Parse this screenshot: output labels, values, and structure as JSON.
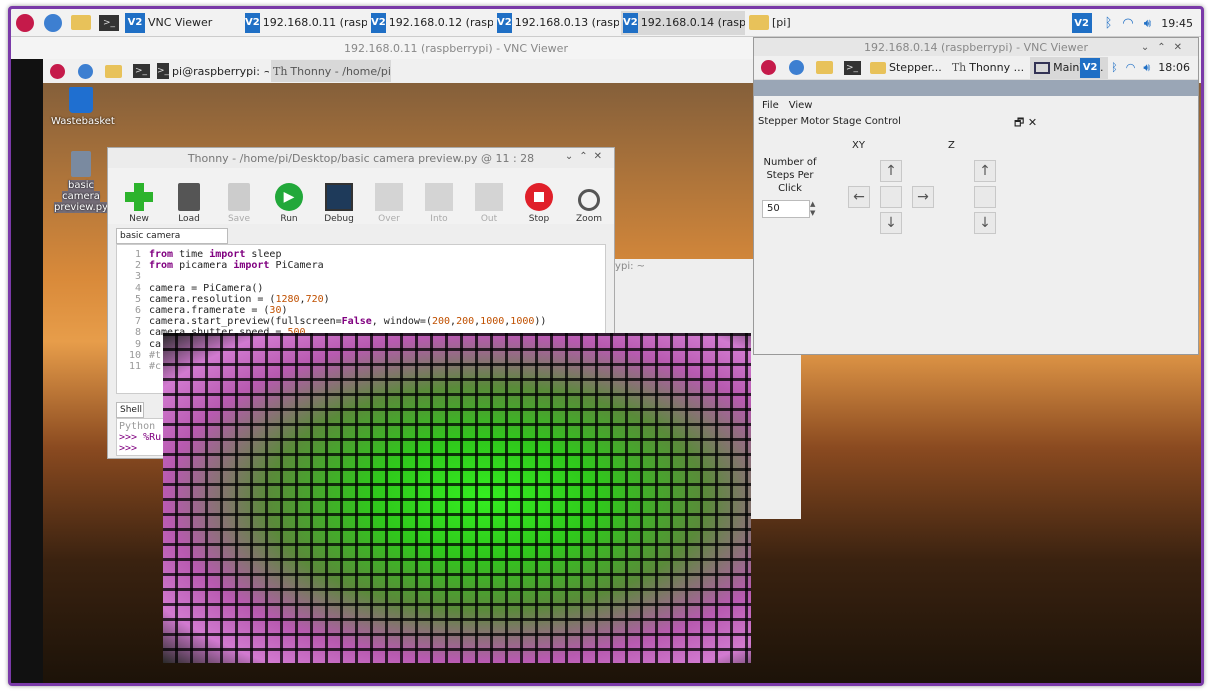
{
  "host_taskbar": {
    "tasks": [
      {
        "label": "VNC Viewer"
      },
      {
        "label": "192.168.0.11 (raspbe..."
      },
      {
        "label": "192.168.0.12 (raspbe..."
      },
      {
        "label": "192.168.0.13 (raspbe..."
      },
      {
        "label": "192.168.0.14 (raspbe..."
      },
      {
        "label": "[pi]"
      }
    ],
    "clock": "19:45"
  },
  "vnc1": {
    "title": "192.168.0.11 (raspberrypi) - VNC Viewer",
    "pi_taskbar": {
      "tasks": [
        {
          "label": "pi@raspberrypi: ~"
        },
        {
          "label": "Thonny  -  /home/pi/..."
        }
      ]
    },
    "desktop": {
      "wastebasket_label": "Wastebasket",
      "file_label": "basic camera preview.py",
      "hidden_terminal_text": "rrypi: ~"
    },
    "thonny": {
      "title": "Thonny  -  /home/pi/Desktop/basic camera preview.py  @  11 : 28",
      "toolbar": [
        {
          "label": "New",
          "enabled": true
        },
        {
          "label": "Load",
          "enabled": true
        },
        {
          "label": "Save",
          "enabled": false
        },
        {
          "label": "Run",
          "enabled": true
        },
        {
          "label": "Debug",
          "enabled": true
        },
        {
          "label": "Over",
          "enabled": false
        },
        {
          "label": "Into",
          "enabled": false
        },
        {
          "label": "Out",
          "enabled": false
        },
        {
          "label": "Stop",
          "enabled": true
        },
        {
          "label": "Zoom",
          "enabled": true
        }
      ],
      "editor_tab": "basic camera preview.py",
      "line_numbers": [
        "1",
        "2",
        "3",
        "4",
        "5",
        "6",
        "7",
        "8",
        "9",
        "10",
        "11"
      ],
      "shell_tab": "Shell",
      "shell_lines": [
        "Python",
        ">>> %Ru",
        ">>>"
      ]
    }
  },
  "vnc2": {
    "title": "192.168.0.14 (raspberrypi) - VNC Viewer",
    "pi_taskbar": {
      "tasks": [
        {
          "label": "Stepper..."
        },
        {
          "label": "Thonny ..."
        },
        {
          "label": "MainWi..."
        }
      ],
      "clock": "18:06"
    },
    "app": {
      "menu": [
        "File",
        "View"
      ],
      "title": "Stepper Motor Stage Control",
      "xy_label": "XY",
      "z_label": "Z",
      "steps_label_lines": [
        "Number of",
        "Steps Per",
        "Click"
      ],
      "steps_value": "50"
    }
  },
  "icons": [
    "raspberry-pi-menu-icon",
    "globe-icon",
    "folder-icon",
    "terminal-icon",
    "vnc-icon",
    "bluetooth-icon",
    "wifi-icon",
    "volume-icon"
  ]
}
